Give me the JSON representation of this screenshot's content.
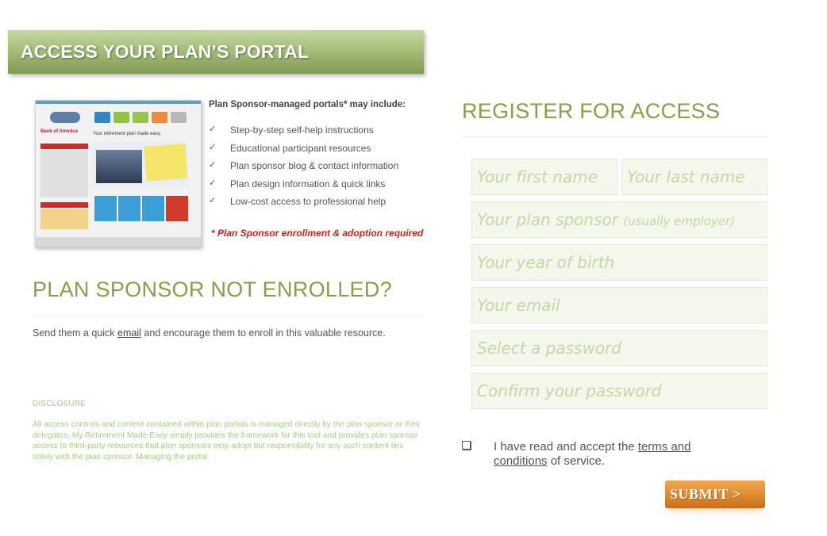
{
  "banner": {
    "title": "ACCESS YOUR PLAN’S PORTAL"
  },
  "preview": {
    "bank_name": "Bank of America",
    "headline": "Your retirement plan made easy."
  },
  "plan_sponsor": {
    "heading": "Plan Sponsor-managed portals* may include:",
    "check_glyph": "✓",
    "items": [
      "Step-by-step self-help instructions",
      "Educational participant resources",
      "Plan sponsor blog & contact information",
      "Plan design information & quick links",
      "Low-cost access to professional help"
    ],
    "note": "*  Plan Sponsor enrollment & adoption required"
  },
  "not_enrolled": {
    "title": "PLAN SPONSOR NOT ENROLLED?",
    "text_before": "Send them a quick ",
    "link": "email",
    "text_after": " and encourage them to enroll in this valuable resource."
  },
  "disclosure": {
    "title": "DISCLOSURE",
    "text": "All access controls and content contained within plan portals is  managed directly by the  plan sponsor or their delegates. My Retirement Made Easy simply provides the framework for this tool and provides plan sponsor access to third-party resources that plan sponsors may adopt but responsibility for any such content lies solely with the plan sponsor. Managing the portal"
  },
  "register": {
    "title": "REGISTER FOR ACCESS",
    "first_name_placeholder": "Your first name",
    "last_name_placeholder": "Your last name",
    "sponsor_placeholder": "Your plan sponsor",
    "sponsor_hint": "(usually employer)",
    "birth_year_placeholder": "Your year of birth",
    "email_placeholder": "Your email",
    "password_placeholder": "Select a password",
    "confirm_password_placeholder": "Confirm your password",
    "agree_before": "I have read and accept the ",
    "agree_link": "terms and conditions",
    "agree_after": " of service.",
    "submit_label": "SUBMIT  >"
  },
  "colors": {
    "banner_green": "#a6bf79",
    "heading_green": "#8a9e4a",
    "note_red": "#c0281e",
    "submit_orange": "#e08a2f",
    "disclosure_green": "#a3d07e"
  }
}
